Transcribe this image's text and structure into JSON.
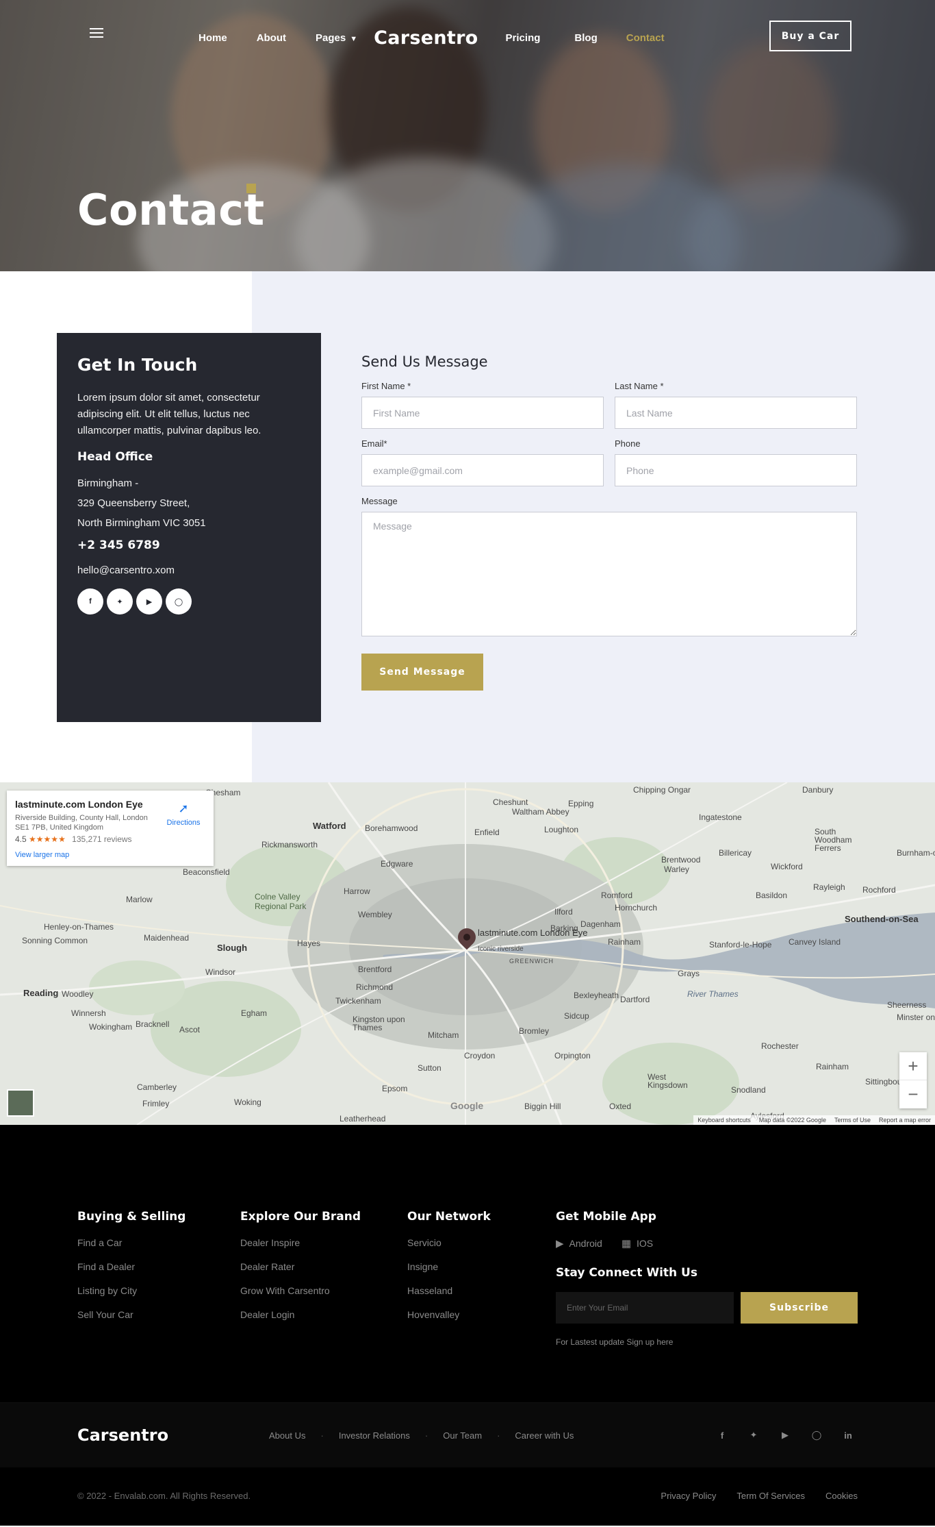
{
  "nav": {
    "links": [
      "Home",
      "About",
      "Pages",
      "Pricing",
      "Blog",
      "Contact"
    ],
    "brand": "Carsentro",
    "active": "Contact",
    "buy_button": "Buy a Car"
  },
  "hero": {
    "title": "Contact"
  },
  "contact_card": {
    "title": "Get In Touch",
    "description": "Lorem ipsum dolor sit amet, consectetur adipiscing elit. Ut elit tellus, luctus nec ullamcorper mattis, pulvinar dapibus leo.",
    "office_heading": "Head Office",
    "address_line1": "Birmingham -",
    "address_line2": "329 Queensberry Street,",
    "address_line3": "North Birmingham VIC 3051",
    "phone": "+2 345 6789",
    "email": "hello@carsentro.xom",
    "socials": [
      "facebook",
      "twitter",
      "youtube",
      "instagram"
    ]
  },
  "form": {
    "title": "Send Us Message",
    "first_name_label": "First Name *",
    "first_name_placeholder": "First Name",
    "last_name_label": "Last Name *",
    "last_name_placeholder": "Last Name",
    "email_label": "Email*",
    "email_placeholder": "example@gmail.com",
    "phone_label": "Phone",
    "phone_placeholder": "Phone",
    "message_label": "Message",
    "message_placeholder": "Message",
    "submit": "Send Message"
  },
  "map": {
    "place_name": "lastminute.com London Eye",
    "place_address": "Riverside Building, County Hall, London SE1 7PB, United Kingdom",
    "rating": "4.5",
    "stars": "★★★★★",
    "reviews": "135,271 reviews",
    "view_larger": "View larger map",
    "directions": "Directions",
    "pin_label": "lastminute.com London Eye",
    "pin_sublabel": "Iconic riverside",
    "google": "Google",
    "attribution": [
      "Keyboard shortcuts",
      "Map data ©2022 Google",
      "Terms of Use",
      "Report a map error"
    ],
    "places": [
      "Watford",
      "Borehamwood",
      "Enfield",
      "Loughton",
      "Epping",
      "Cheshunt",
      "Waltham Abbey",
      "Chipping Ongar",
      "Ingatestone",
      "Danbury",
      "Rickmansworth",
      "Chesham",
      "Beaconsfield",
      "Edgware",
      "Harrow",
      "Wembley",
      "Colne Valley Regional Park",
      "Marlow",
      "Henley-on-Thames",
      "Sonning Common",
      "Maidenhead",
      "Slough",
      "Hayes",
      "Windsor",
      "Brentford",
      "Reading",
      "Woodley",
      "Winnersh",
      "Wokingham",
      "Bracknell",
      "Ascot",
      "Egham",
      "Richmond",
      "Twickenham",
      "Kingston upon Thames",
      "Mitcham",
      "Croydon",
      "Sutton",
      "Epsom",
      "Camberley",
      "Frimley",
      "Woking",
      "Leatherhead",
      "Biggin Hill",
      "Oxted",
      "West Kingsdown",
      "Orpington",
      "Bromley",
      "Sidcup",
      "Bexleyheath",
      "Dartford",
      "Grays",
      "Rainham",
      "Dagenham",
      "Barking",
      "Ilford",
      "Romford",
      "Hornchurch",
      "Brentwood",
      "Warley",
      "Billericay",
      "Wickford",
      "Basildon",
      "Rayleigh",
      "Rochford",
      "South Woodham Ferrers",
      "Southend-on-Sea",
      "Canvey Island",
      "Stanford-le-Hope",
      "Rochester",
      "Snodland",
      "Aylesford",
      "Sittingbourne",
      "Sheerness",
      "Minster on Sea",
      "Burnham-on-Crouch",
      "GREENWICH",
      "River Thames",
      "Rainham"
    ]
  },
  "footer": {
    "col1": {
      "title": "Buying & Selling",
      "links": [
        "Find a Car",
        "Find a Dealer",
        "Listing by City",
        "Sell Your Car"
      ]
    },
    "col2": {
      "title": "Explore Our Brand",
      "links": [
        "Dealer Inspire",
        "Dealer Rater",
        "Grow With Carsentro",
        "Dealer Login"
      ]
    },
    "col3": {
      "title": "Our Network",
      "links": [
        "Servicio",
        "Insigne",
        "Hasseland",
        "Hovenvalley"
      ]
    },
    "app": {
      "title": "Get Mobile App",
      "android": "Android",
      "ios": "IOS"
    },
    "connect": {
      "title": "Stay Connect With Us",
      "placeholder": "Enter Your Email",
      "button": "Subscribe",
      "note": "For Lastest update Sign up here"
    },
    "brand": "Carsentro",
    "mid_links": [
      "About Us",
      "Investor Relations",
      "Our Team",
      "Career with Us"
    ],
    "socials": [
      "facebook",
      "twitter",
      "youtube",
      "instagram",
      "linkedin"
    ],
    "copyright": "© 2022 - Envalab.com. All Rights Reserved.",
    "legal": [
      "Privacy Policy",
      "Term Of Services",
      "Cookies"
    ]
  },
  "colors": {
    "accent": "#b8a350",
    "card_dark": "#262830",
    "form_bg": "#eef0f8"
  }
}
